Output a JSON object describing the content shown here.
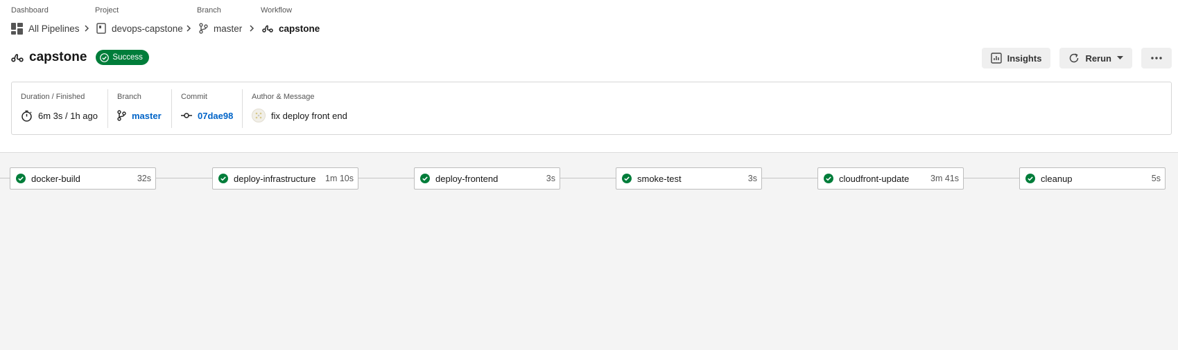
{
  "breadcrumb": {
    "labels": [
      "Dashboard",
      "Project",
      "Branch",
      "Workflow"
    ],
    "dashboard": "All Pipelines",
    "project": "devops-capstone",
    "branch": "master",
    "workflow": "capstone"
  },
  "header": {
    "title": "capstone",
    "status": "Success",
    "status_color": "#007d3a",
    "insights_label": "Insights",
    "rerun_label": "Rerun"
  },
  "info": {
    "duration_label": "Duration / Finished",
    "duration_value": "6m 3s / 1h ago",
    "branch_label": "Branch",
    "branch_value": "master",
    "commit_label": "Commit",
    "commit_value": "07dae98",
    "author_label": "Author & Message",
    "message": "fix deploy front end"
  },
  "jobs": [
    {
      "name": "docker-build",
      "duration": "32s",
      "status": "success"
    },
    {
      "name": "deploy-infrastructure",
      "duration": "1m 10s",
      "status": "success"
    },
    {
      "name": "deploy-frontend",
      "duration": "3s",
      "status": "success"
    },
    {
      "name": "smoke-test",
      "duration": "3s",
      "status": "success"
    },
    {
      "name": "cloudfront-update",
      "duration": "3m 41s",
      "status": "success"
    },
    {
      "name": "cleanup",
      "duration": "5s",
      "status": "success"
    }
  ],
  "colors": {
    "success": "#007d3a",
    "link": "#0064c8"
  }
}
